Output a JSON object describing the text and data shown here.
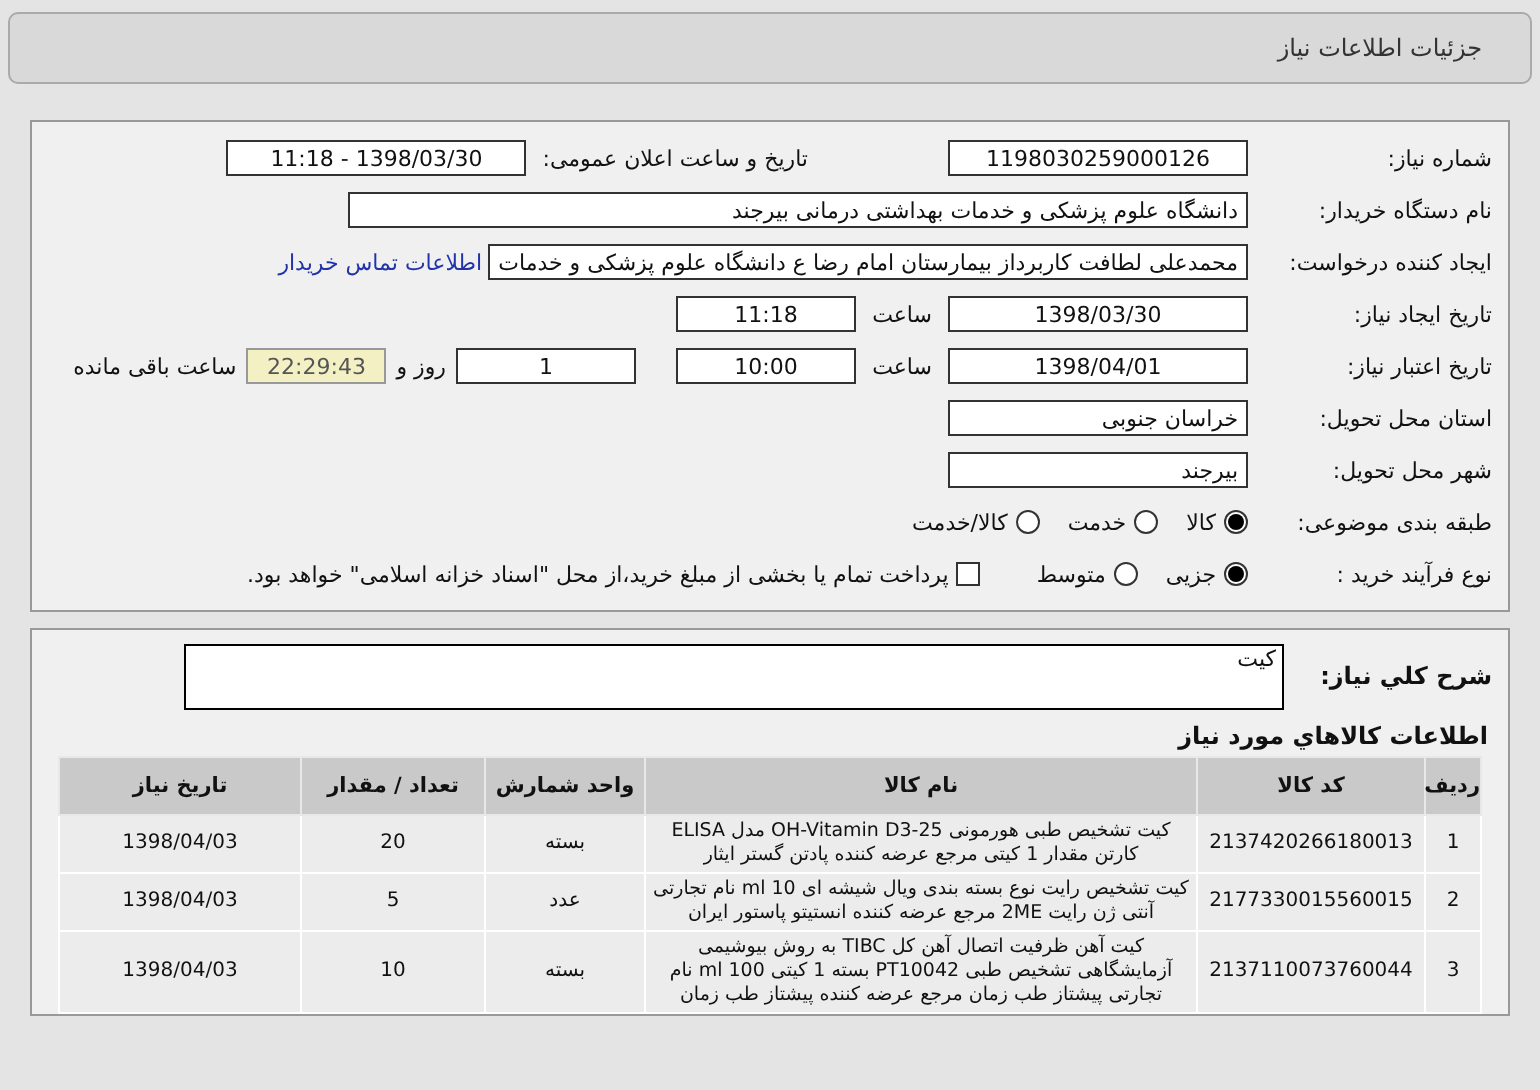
{
  "page_title": "جزئیات اطلاعات نیاز",
  "need_number": {
    "label": "شماره نیاز:",
    "value": "1198030259000126"
  },
  "announce": {
    "label": "تاریخ و ساعت اعلان عمومی:",
    "value": "1398/03/30 - 11:18"
  },
  "buyer": {
    "label": "نام دستگاه خریدار:",
    "value": "دانشگاه علوم پزشکی و خدمات بهداشتی درمانی بیرجند"
  },
  "creator": {
    "label": "ایجاد کننده درخواست:",
    "value": "محمدعلی لطافت کاربرداز بیمارستان امام رضا ع دانشگاه علوم پزشکی و خدمات",
    "link": "اطلاعات تماس خریدار"
  },
  "created": {
    "label": "تاریخ ایجاد نیاز:",
    "date": "1398/03/30",
    "time_label": "ساعت",
    "time": "11:18"
  },
  "validity": {
    "label": "تاریخ اعتبار نیاز:",
    "date": "1398/04/01",
    "time_label": "ساعت",
    "time": "10:00",
    "days": "1",
    "days_label": "روز و",
    "remaining": "22:29:43",
    "remaining_label": "ساعت باقی مانده"
  },
  "province": {
    "label": "استان محل تحویل:",
    "value": "خراسان جنوبی"
  },
  "city": {
    "label": "شهر محل تحویل:",
    "value": "بیرجند"
  },
  "category": {
    "label": "طبقه بندی موضوعی:",
    "options": [
      {
        "label": "کالا",
        "selected": true
      },
      {
        "label": "خدمت",
        "selected": false
      },
      {
        "label": "کالا/خدمت",
        "selected": false
      }
    ]
  },
  "purchase": {
    "label": "نوع فرآیند خرید :",
    "options": [
      {
        "label": "جزیی",
        "selected": true
      },
      {
        "label": "متوسط",
        "selected": false
      }
    ],
    "payment": {
      "label": "پرداخت تمام یا بخشی از مبلغ خرید،از محل \"اسناد خزانه اسلامی\" خواهد بود.",
      "checked": false
    }
  },
  "description": {
    "label": "شرح کلي نياز:",
    "value": "کیت"
  },
  "items": {
    "title": "اطلاعات کالاهاي مورد نياز",
    "columns": [
      "ردیف",
      "کد کالا",
      "نام کالا",
      "واحد شمارش",
      "تعداد / مقدار",
      "تاریخ نیاز"
    ],
    "rows": [
      [
        "1",
        "2137420266180013",
        "کیت تشخیص طبی هورمونی OH-Vitamin D3-25 مدل ELISA کارتن مقدار 1 کیتی مرجع عرضه کننده پادتن گستر ایثار",
        "بسته",
        "20",
        "1398/04/03"
      ],
      [
        "2",
        "2177330015560015",
        "کیت تشخیص رایت نوع بسته بندی ویال شیشه ای 10 ml نام تجارتی آنتی ژن رایت 2ME مرجع عرضه کننده انستیتو پاستور ایران",
        "عدد",
        "5",
        "1398/04/03"
      ],
      [
        "3",
        "2137110073760044",
        "کیت آهن ظرفیت اتصال آهن کل TIBC به روش بیوشیمی آزمایشگاهی تشخیص طبی PT10042 بسته 1 کیتی 100 ml نام تجارتی پیشتاز طب زمان مرجع عرضه کننده پیشتاز طب زمان",
        "بسته",
        "10",
        "1398/04/03"
      ]
    ]
  }
}
